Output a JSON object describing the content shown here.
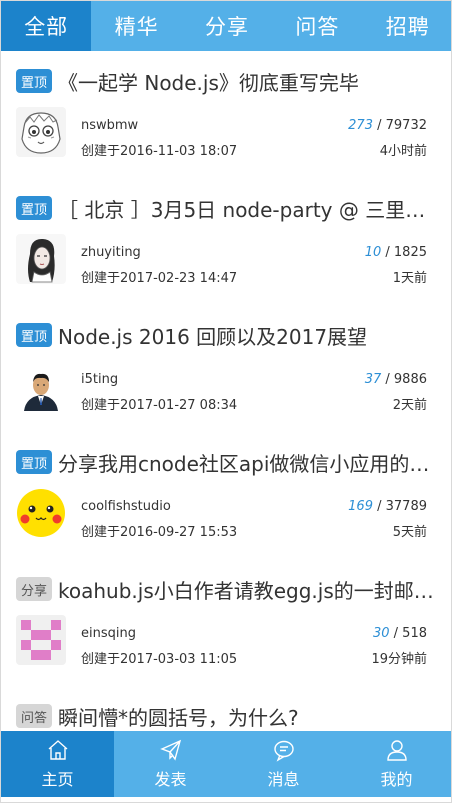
{
  "tabs": [
    {
      "label": "全部",
      "active": true
    },
    {
      "label": "精华",
      "active": false
    },
    {
      "label": "分享",
      "active": false
    },
    {
      "label": "问答",
      "active": false
    },
    {
      "label": "招聘",
      "active": false
    }
  ],
  "topics": [
    {
      "badge": "置顶",
      "badge_type": "top",
      "title": "《一起学 Node.js》彻底重写完毕",
      "author": "nswbmw",
      "created": "创建于2016-11-03 18:07",
      "replies": "273",
      "views": "/ 79732",
      "ago": "4小时前",
      "avatar_icon": "cartoon-face-avatar"
    },
    {
      "badge": "置顶",
      "badge_type": "top",
      "title": "［ 北京 ］3月5日 node-party @ 三里屯…",
      "author": "zhuyiting",
      "created": "创建于2017-02-23 14:47",
      "replies": "10",
      "views": "/ 1825",
      "ago": "1天前",
      "avatar_icon": "sketch-portrait-avatar"
    },
    {
      "badge": "置顶",
      "badge_type": "top",
      "title": "Node.js 2016 回顾以及2017展望",
      "author": "i5ting",
      "created": "创建于2017-01-27 08:34",
      "replies": "37",
      "views": "/ 9886",
      "ago": "2天前",
      "avatar_icon": "man-in-suit-avatar"
    },
    {
      "badge": "置顶",
      "badge_type": "top",
      "title": "分享我用cnode社区api做微信小应用的…",
      "author": "coolfishstudio",
      "created": "创建于2016-09-27 15:53",
      "replies": "169",
      "views": "/ 37789",
      "ago": "5天前",
      "avatar_icon": "pikachu-avatar"
    },
    {
      "badge": "分享",
      "badge_type": "gray",
      "title": "koahub.js小白作者请教egg.js的一封邮…",
      "author": "einsqing",
      "created": "创建于2017-03-03 11:05",
      "replies": "30",
      "views": "/ 518",
      "ago": "19分钟前",
      "avatar_icon": "pixel-identicon-avatar"
    },
    {
      "badge": "问答",
      "badge_type": "gray",
      "title": "瞬间懵*的圆括号，为什么?",
      "author": "",
      "created": "",
      "replies": "",
      "views": "",
      "ago": "",
      "avatar_icon": ""
    }
  ],
  "bottom_nav": [
    {
      "label": "主页",
      "icon": "home-icon",
      "active": true
    },
    {
      "label": "发表",
      "icon": "paper-plane-icon",
      "active": false
    },
    {
      "label": "消息",
      "icon": "chat-bubble-icon",
      "active": false
    },
    {
      "label": "我的",
      "icon": "user-icon",
      "active": false
    }
  ],
  "colors": {
    "bar": "#54b0e8",
    "bar_active": "#1c83cb",
    "badge_top": "#2d8fd5",
    "badge_gray": "#d6d6d6"
  }
}
